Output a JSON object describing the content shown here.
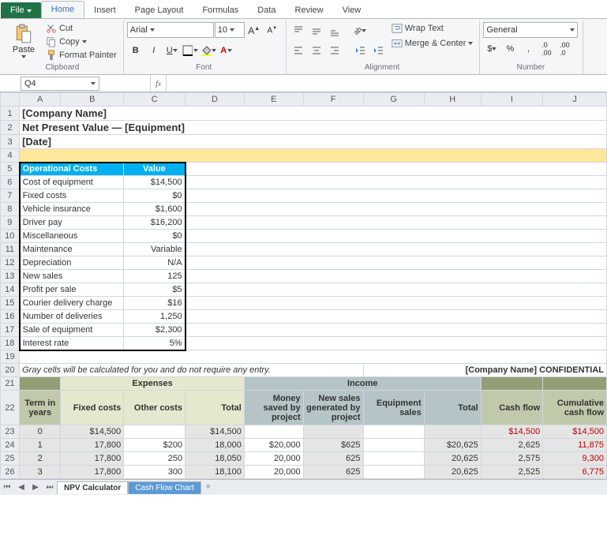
{
  "tabs": {
    "file": "File",
    "home": "Home",
    "insert": "Insert",
    "pageLayout": "Page Layout",
    "formulas": "Formulas",
    "data": "Data",
    "review": "Review",
    "view": "View"
  },
  "clipboard": {
    "paste": "Paste",
    "cut": "Cut",
    "copy": "Copy",
    "formatPainter": "Format Painter",
    "label": "Clipboard"
  },
  "font": {
    "name": "Arial",
    "size": "10",
    "label": "Font"
  },
  "alignment": {
    "wrap": "Wrap Text",
    "merge": "Merge & Center",
    "label": "Alignment"
  },
  "number": {
    "format": "General",
    "label": "Number"
  },
  "namebox": "Q4",
  "fx": "",
  "cols": [
    "A",
    "B",
    "C",
    "D",
    "E",
    "F",
    "G",
    "H",
    "I",
    "J"
  ],
  "title1": "[Company Name]",
  "title2": "Net Present Value — [Equipment]",
  "title3": "[Date]",
  "opHdr": {
    "a": "Operational Costs",
    "b": "Value"
  },
  "op": [
    {
      "l": "Cost of equipment",
      "v": "$14,500"
    },
    {
      "l": "Fixed costs",
      "v": "$0"
    },
    {
      "l": "Vehicle insurance",
      "v": "$1,600"
    },
    {
      "l": "Driver pay",
      "v": "$16,200"
    },
    {
      "l": "Miscellaneous",
      "v": "$0"
    },
    {
      "l": "Maintenance",
      "v": "Variable"
    },
    {
      "l": "Depreciation",
      "v": "N/A"
    },
    {
      "l": "New sales",
      "v": "125"
    },
    {
      "l": "Profit per sale",
      "v": "$5"
    },
    {
      "l": "Courier delivery charge",
      "v": "$16"
    },
    {
      "l": "Number of deliveries",
      "v": "1,250"
    },
    {
      "l": "Sale of equipment",
      "v": "$2,300"
    },
    {
      "l": "Interest rate",
      "v": "5%"
    }
  ],
  "note": "Gray cells will be calculated for you and do not require any entry.",
  "conf": "[Company Name] CONFIDENTIAL",
  "secExpenses": "Expenses",
  "secIncome": "Income",
  "h": {
    "term": "Term in years",
    "fixed": "Fixed costs",
    "other": "Other costs",
    "total": "Total",
    "saved": "Money saved by project",
    "newsales": "New sales generated by project",
    "equip": "Equipment sales",
    "itotal": "Total",
    "cashflow": "Cash flow",
    "cumcf": "Cumulative cash flow"
  },
  "rows": [
    {
      "t": "0",
      "fc": "$14,500",
      "oc": "",
      "tot": "$14,500",
      "ms": "",
      "ns": "",
      "es": "",
      "it": "",
      "cf": "$14,500",
      "cc": "$14,500"
    },
    {
      "t": "1",
      "fc": "17,800",
      "oc": "$200",
      "tot": "18,000",
      "ms": "$20,000",
      "ns": "$625",
      "es": "",
      "it": "$20,625",
      "cf": "2,625",
      "cc": "11,875"
    },
    {
      "t": "2",
      "fc": "17,800",
      "oc": "250",
      "tot": "18,050",
      "ms": "20,000",
      "ns": "625",
      "es": "",
      "it": "20,625",
      "cf": "2,575",
      "cc": "9,300"
    },
    {
      "t": "3",
      "fc": "17,800",
      "oc": "300",
      "tot": "18,100",
      "ms": "20,000",
      "ns": "625",
      "es": "",
      "it": "20,625",
      "cf": "2,525",
      "cc": "6,775"
    }
  ],
  "sheets": {
    "s1": "NPV Calculator",
    "s2": "Cash Flow Chart"
  }
}
